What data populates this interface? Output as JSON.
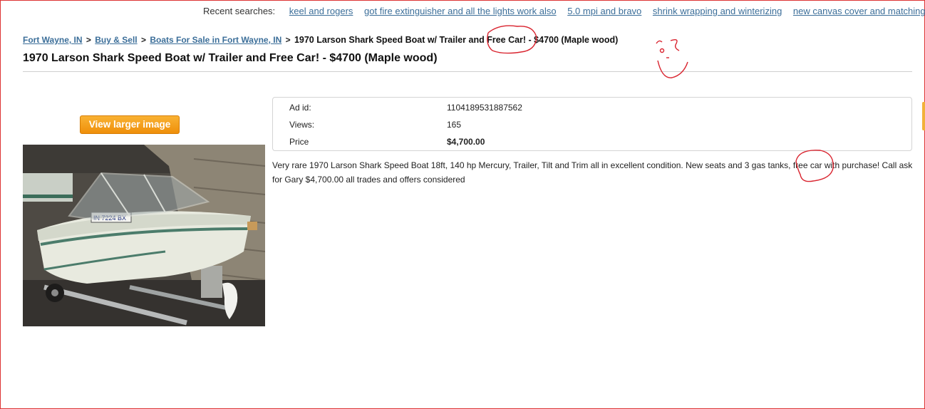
{
  "recent_searches": {
    "label": "Recent searches:",
    "items": [
      "keel and rogers",
      "got fire extinguisher and all the lights work also",
      "5.0 mpi and bravo",
      "shrink wrapping and winterizing",
      "new canvas cover and matching"
    ]
  },
  "breadcrumb": {
    "items": [
      "Fort Wayne, IN",
      "Buy & Sell",
      "Boats For Sale in Fort Wayne, IN"
    ],
    "separator": ">",
    "current": "1970 Larson Shark Speed Boat w/ Trailer and Free Car! - $4700 (Maple wood)"
  },
  "page": {
    "title": "1970 Larson Shark Speed Boat w/ Trailer and Free Car! - $4700 (Maple wood)"
  },
  "gallery": {
    "view_button": "View larger image",
    "photo_tag": "IN 7224 BX"
  },
  "details": {
    "ad_id_label": "Ad id:",
    "ad_id": "1104189531887562",
    "views_label": "Views:",
    "views": "165",
    "price_label": "Price",
    "price": "$4,700.00"
  },
  "description": "Very rare 1970 Larson Shark Speed Boat 18ft, 140 hp Mercury, Trailer, Tilt and Trim all in excellent condition. New seats and 3 gas tanks, free car with purchase! Call ask for Gary $4,700.00 all trades and offers considered",
  "colors": {
    "link": "#3b6e99",
    "button": "#ef8f0a",
    "annotation": "#d9232e"
  }
}
